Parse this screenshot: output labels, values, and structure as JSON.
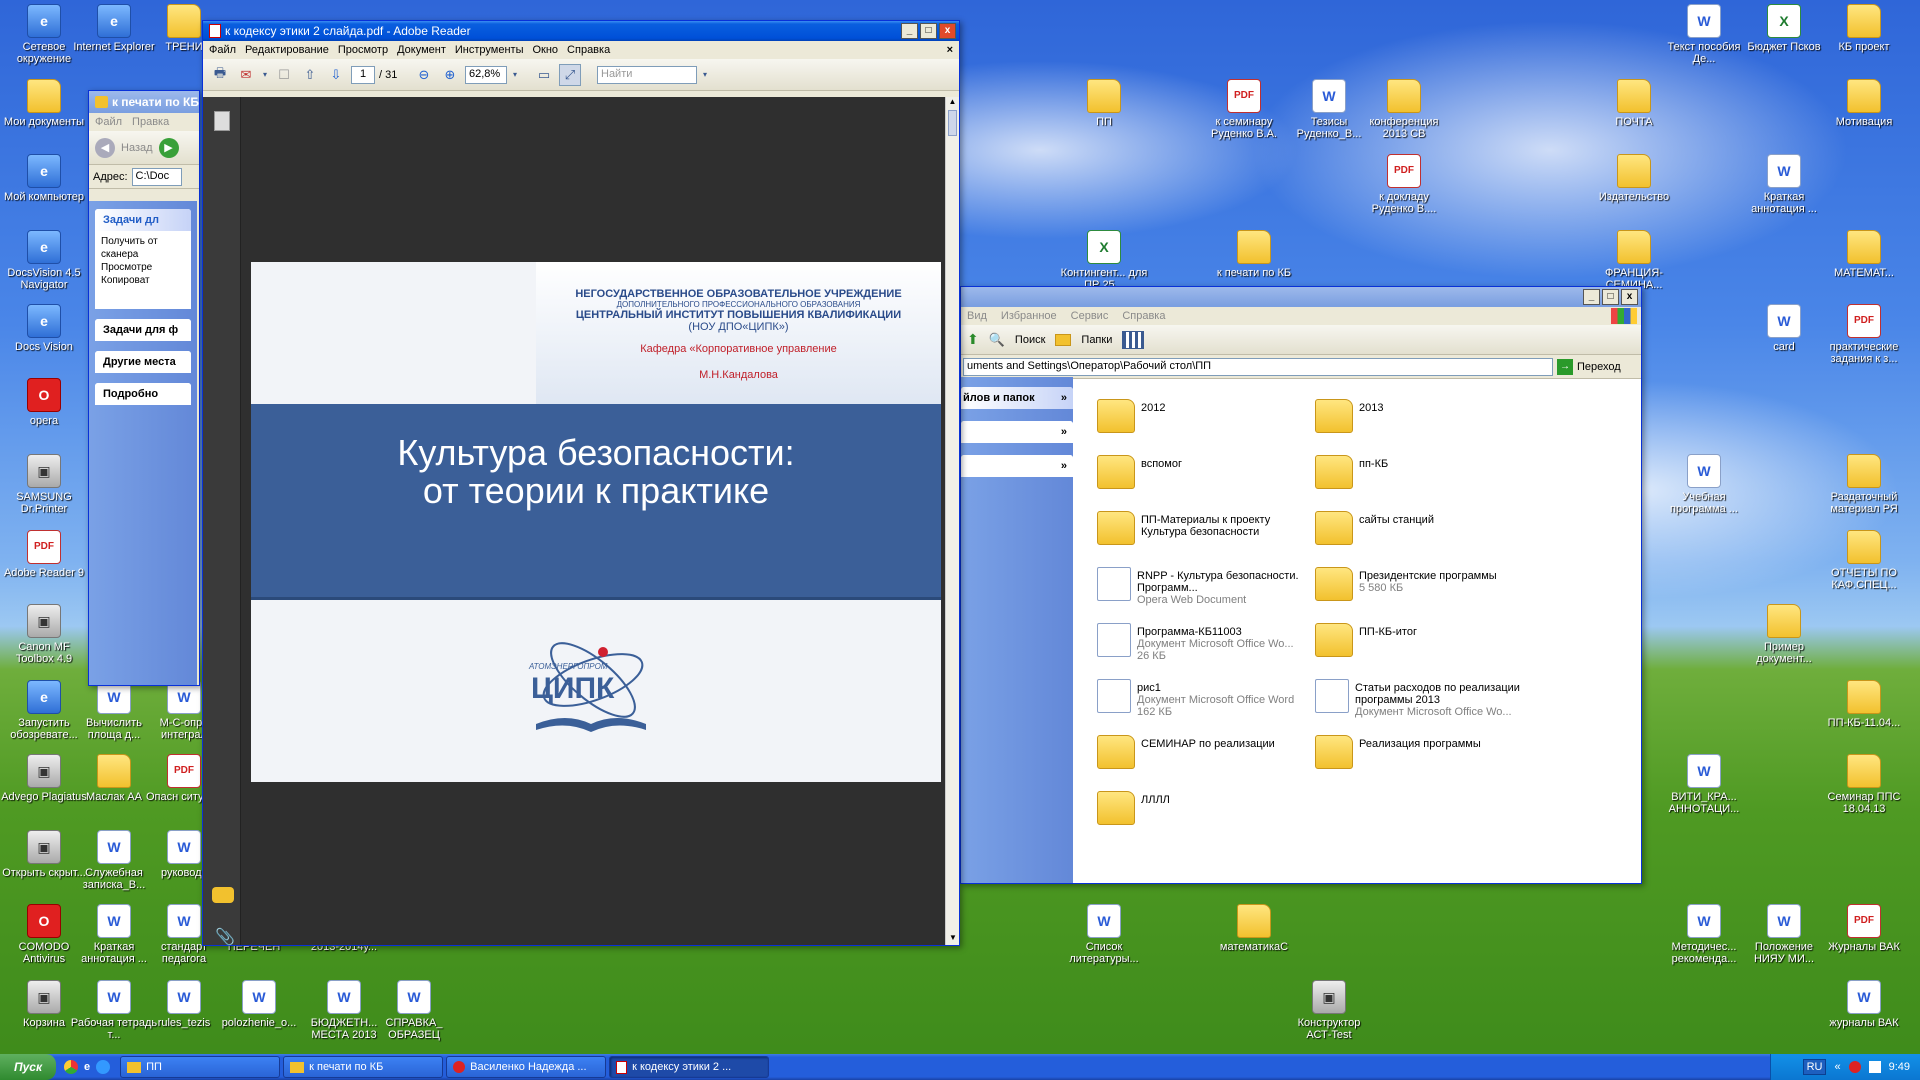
{
  "desktop_left": [
    {
      "label": "Сетевое окружение",
      "kind": "sys"
    },
    {
      "label": "Internet Explorer",
      "kind": "sys"
    },
    {
      "label": "ТРЕНИ",
      "kind": "folder"
    },
    {
      "label": "Мои документы",
      "kind": "folder"
    },
    {
      "label": "Мой компьютер",
      "kind": "sys"
    },
    {
      "label": "DocsVision 4.5 Navigator",
      "kind": "sys"
    },
    {
      "label": "Docs Vision",
      "kind": "sys"
    },
    {
      "label": "opera",
      "kind": "red"
    },
    {
      "label": "SAMSUNG Dr.Printer",
      "kind": "grey"
    },
    {
      "label": "Adobe Reader 9",
      "kind": "pdf"
    },
    {
      "label": "Canon MF Toolbox 4.9",
      "kind": "grey"
    },
    {
      "label": "Запустить обозревате...",
      "kind": "sys"
    },
    {
      "label": "Вычислить площа д...",
      "kind": "doc"
    },
    {
      "label": "М-С-опре интеграл",
      "kind": "doc"
    },
    {
      "label": "Advego Plagiatus",
      "kind": "grey"
    },
    {
      "label": "Маслак АА",
      "kind": "folder"
    },
    {
      "label": "Опасн ситуаци",
      "kind": "pdf"
    },
    {
      "label": "Открыть скрыт...",
      "kind": "grey"
    },
    {
      "label": "Служебная записка_В...",
      "kind": "doc"
    },
    {
      "label": "руководс",
      "kind": "doc"
    },
    {
      "label": "COMODO Antivirus",
      "kind": "red"
    },
    {
      "label": "Краткая аннотация ...",
      "kind": "doc"
    },
    {
      "label": "стандарт педагога",
      "kind": "doc"
    },
    {
      "label": "ПЕРЕЧЕН",
      "kind": "doc"
    },
    {
      "label": "2013-2014у...",
      "kind": "doc"
    },
    {
      "label": "Корзина",
      "kind": "grey"
    },
    {
      "label": "Рабочая тетрадь т...",
      "kind": "doc"
    },
    {
      "label": "rules_tezis",
      "kind": "doc"
    },
    {
      "label": "polozhenie_o...",
      "kind": "doc"
    },
    {
      "label": "БЮДЖЕТН... МЕСТА 2013",
      "kind": "doc"
    },
    {
      "label": "СПРАВКА_ ОБРАЗЕЦ",
      "kind": "doc"
    }
  ],
  "desktop_right": [
    {
      "label": "Текст пособия Де...",
      "kind": "doc"
    },
    {
      "label": "Бюджет Псков",
      "kind": "xls"
    },
    {
      "label": "КБ проект",
      "kind": "folder"
    },
    {
      "label": "ПП",
      "kind": "folder"
    },
    {
      "label": "к семинару Руденко В.А.",
      "kind": "pdf"
    },
    {
      "label": "Тезисы Руденко_В...",
      "kind": "doc"
    },
    {
      "label": "конференция 2013 СВ",
      "kind": "folder"
    },
    {
      "label": "ПОЧТА",
      "kind": "folder"
    },
    {
      "label": "Мотивация",
      "kind": "folder"
    },
    {
      "label": "к докладу Руденко В....",
      "kind": "pdf"
    },
    {
      "label": "Издательство",
      "kind": "folder"
    },
    {
      "label": "Краткая аннотация ...",
      "kind": "doc"
    },
    {
      "label": "Контингент... для ПР 25...",
      "kind": "xls"
    },
    {
      "label": "к печати по КБ",
      "kind": "folder"
    },
    {
      "label": "ФРАНЦИЯ-СЕМИНА...",
      "kind": "folder"
    },
    {
      "label": "МАТЕМАТ...",
      "kind": "folder"
    },
    {
      "label": "Учебная программа ...",
      "kind": "doc"
    },
    {
      "label": "card",
      "kind": "doc"
    },
    {
      "label": "практические задания к з...",
      "kind": "pdf"
    },
    {
      "label": "Раздаточный материал РЯ",
      "kind": "folder"
    },
    {
      "label": "ОТЧЕТЫ ПО КАФ.СПЕЦ...",
      "kind": "folder"
    },
    {
      "label": "Пример документ...",
      "kind": "folder"
    },
    {
      "label": "ПП-КБ-11.04...",
      "kind": "folder"
    },
    {
      "label": "ВИТИ_КРА... АННОТАЦИ...",
      "kind": "doc"
    },
    {
      "label": "Семинар ППС 18.04.13",
      "kind": "folder"
    },
    {
      "label": "Список литературы...",
      "kind": "doc"
    },
    {
      "label": "математикаС",
      "kind": "folder"
    },
    {
      "label": "Методичес... рекоменда...",
      "kind": "doc"
    },
    {
      "label": "Положение НИЯУ МИ...",
      "kind": "doc"
    },
    {
      "label": "Журналы ВАК",
      "kind": "pdf"
    },
    {
      "label": "Конструктор АСТ-Test",
      "kind": "grey"
    },
    {
      "label": "журналы ВАК",
      "kind": "doc"
    }
  ],
  "explorer_back": {
    "title": "к печати по КБ",
    "menu": [
      "Файл",
      "Правка"
    ],
    "back_label": "Назад",
    "address_label": "Адрес:",
    "address_value": "C:\\Doc",
    "task_header": "Задачи дл",
    "tasks": [
      "Получить от сканера",
      "Просмотре",
      "Копироват"
    ],
    "sections": [
      "Задачи для ф",
      "Другие места",
      "Подробно"
    ]
  },
  "adobe": {
    "title": "к кодексу этики 2 слайда.pdf - Adobe Reader",
    "menu": [
      "Файл",
      "Редактирование",
      "Просмотр",
      "Документ",
      "Инструменты",
      "Окно",
      "Справка"
    ],
    "page_current": "1",
    "page_total": "/ 31",
    "zoom": "62,8%",
    "search_placeholder": "Найти",
    "slide": {
      "org_line1": "НЕГОСУДАРСТВЕННОЕ ОБРАЗОВАТЕЛЬНОЕ УЧРЕЖДЕНИЕ",
      "org_line2": "ДОПОЛНИТЕЛЬНОГО ПРОФЕССИОНАЛЬНОГО ОБРАЗОВАНИЯ",
      "org_line3": "ЦЕНТРАЛЬНЫЙ ИНСТИТУТ ПОВЫШЕНИЯ КВАЛИФИКАЦИИ",
      "org_line4": "(НОУ ДПО«ЦИПК»)",
      "dept": "Кафедра «Корпоративное управление",
      "author": "М.Н.Кандалова",
      "title_line1": "Культура безопасности:",
      "title_line2": "от теории к практике",
      "logo_top": "АТОМЭНЕРГОПРОМ",
      "logo_main": "ЦИПК"
    }
  },
  "explorer_pp": {
    "menu": [
      "Вид",
      "Избранное",
      "Сервис",
      "Справка"
    ],
    "search_label": "Поиск",
    "folders_label": "Папки",
    "address": "uments and Settings\\Оператор\\Рабочий стол\\ПП",
    "go_label": "Переход",
    "panel_header": "йлов и папок",
    "items": [
      {
        "name": "2012",
        "sub1": "",
        "sub2": "",
        "type": "folder"
      },
      {
        "name": "2013",
        "sub1": "",
        "sub2": "",
        "type": "folder"
      },
      {
        "name": "вспомог",
        "sub1": "",
        "sub2": "",
        "type": "folder"
      },
      {
        "name": "пп-КБ",
        "sub1": "",
        "sub2": "",
        "type": "folder"
      },
      {
        "name": "ПП-Материалы к проекту Культура безопасности",
        "sub1": "",
        "sub2": "",
        "type": "folder"
      },
      {
        "name": "сайты станций",
        "sub1": "",
        "sub2": "",
        "type": "folder"
      },
      {
        "name": "RNPP - Культура безопасности. Программ...",
        "sub1": "Opera Web Document",
        "sub2": "",
        "type": "doc"
      },
      {
        "name": "Президентские программы",
        "sub1": "5 580 КБ",
        "sub2": "",
        "type": "folder"
      },
      {
        "name": "Программа-КБ11003",
        "sub1": "Документ Microsoft Office Wo...",
        "sub2": "26 КБ",
        "type": "doc"
      },
      {
        "name": "ПП-КБ-итог",
        "sub1": "",
        "sub2": "",
        "type": "folder"
      },
      {
        "name": "рис1",
        "sub1": "Документ Microsoft Office Word",
        "sub2": "162 КБ",
        "type": "doc"
      },
      {
        "name": "Статьи расходов по реализации программы 2013",
        "sub1": "Документ Microsoft Office Wo...",
        "sub2": "",
        "type": "doc"
      },
      {
        "name": "СЕМИНАР по реализации",
        "sub1": "",
        "sub2": "",
        "type": "folder"
      },
      {
        "name": "Реализация программы",
        "sub1": "",
        "sub2": "",
        "type": "folder"
      },
      {
        "name": "ЛЛЛЛ",
        "sub1": "",
        "sub2": "",
        "type": "folder"
      }
    ]
  },
  "taskbar": {
    "start_label": "Пуск",
    "tasks": [
      "ПП",
      "к печати по КБ",
      "Василенко Надежда ...",
      "к кодексу этики 2 ..."
    ],
    "lang": "RU",
    "clock": "9:49"
  }
}
